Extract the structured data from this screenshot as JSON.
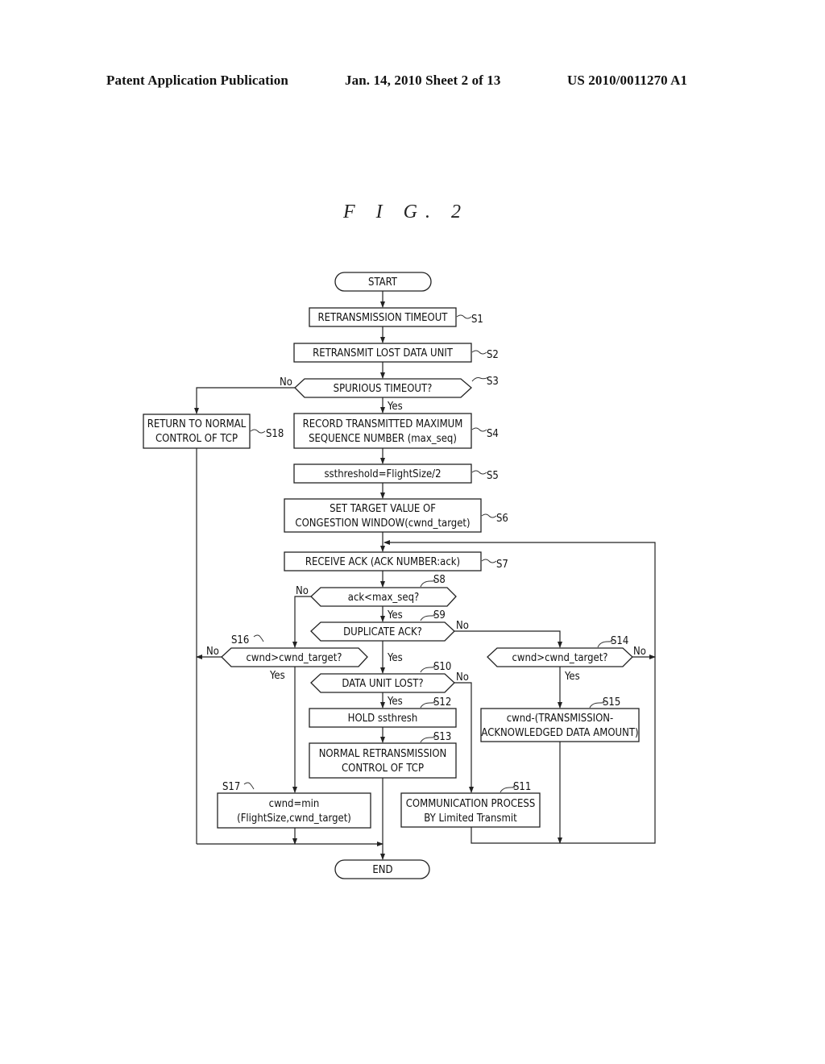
{
  "header": {
    "left": "Patent Application Publication",
    "middle": "Jan. 14, 2010  Sheet 2 of 13",
    "right": "US 2010/0011270 A1"
  },
  "figure_title": "F I G. 2",
  "nodes": {
    "start": "START",
    "s1": {
      "text": [
        "RETRANSMISSION TIMEOUT"
      ],
      "label": "S1"
    },
    "s2": {
      "text": [
        "RETRANSMIT LOST DATA UNIT"
      ],
      "label": "S2"
    },
    "s3": {
      "text": [
        "SPURIOUS TIMEOUT?"
      ],
      "label": "S3"
    },
    "s4": {
      "text": [
        "RECORD TRANSMITTED MAXIMUM",
        "SEQUENCE NUMBER (max_seq)"
      ],
      "label": "S4"
    },
    "s5": {
      "text": [
        "ssthreshold=FlightSize/2"
      ],
      "label": "S5"
    },
    "s6": {
      "text": [
        "SET TARGET VALUE OF",
        "CONGESTION WINDOW(cwnd_target)"
      ],
      "label": "S6"
    },
    "s7": {
      "text": [
        "RECEIVE ACK (ACK NUMBER:ack)"
      ],
      "label": "S7"
    },
    "s8": {
      "text": [
        "ack<max_seq?"
      ],
      "label": "S8"
    },
    "s9": {
      "text": [
        "DUPLICATE ACK?"
      ],
      "label": "S9"
    },
    "s10": {
      "text": [
        "DATA UNIT LOST?"
      ],
      "label": "S10"
    },
    "s11": {
      "text": [
        "COMMUNICATION PROCESS",
        "BY Limited Transmit"
      ],
      "label": "S11"
    },
    "s12": {
      "text": [
        "HOLD ssthresh"
      ],
      "label": "S12"
    },
    "s13": {
      "text": [
        "NORMAL RETRANSMISSION",
        "CONTROL OF TCP"
      ],
      "label": "S13"
    },
    "s14": {
      "text": [
        "cwnd>cwnd_target?"
      ],
      "label": "S14"
    },
    "s15": {
      "text": [
        "cwnd-(TRANSMISSION-",
        "ACKNOWLEDGED DATA AMOUNT)"
      ],
      "label": "S15"
    },
    "s16": {
      "text": [
        "cwnd>cwnd_target?"
      ],
      "label": "S16"
    },
    "s17": {
      "text": [
        "cwnd=min",
        "(FlightSize,cwnd_target)"
      ],
      "label": "S17"
    },
    "s18": {
      "text": [
        "RETURN TO NORMAL",
        "CONTROL OF TCP"
      ],
      "label": "S18"
    },
    "end": "END"
  },
  "branch_labels": {
    "yes": "Yes",
    "no": "No"
  }
}
